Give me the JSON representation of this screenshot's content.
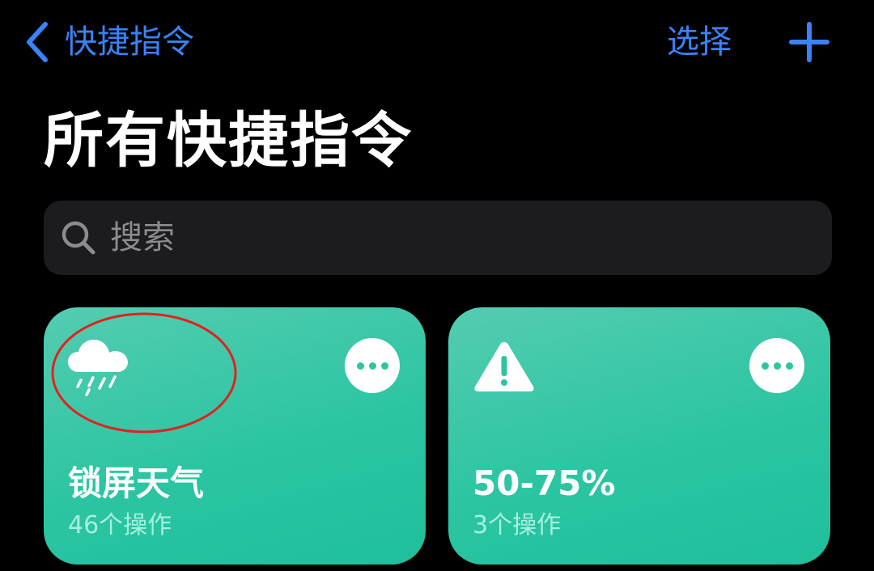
{
  "nav": {
    "back_label": "快捷指令",
    "select_label": "选择",
    "add_icon": "plus-icon",
    "back_icon": "chevron-left-icon"
  },
  "page": {
    "title": "所有快捷指令"
  },
  "search": {
    "placeholder": "搜索",
    "value": "",
    "icon": "search-icon"
  },
  "cards": [
    {
      "title": "锁屏天气",
      "subtitle": "46个操作",
      "icon": "cloud-rain-icon",
      "more_icon": "ellipsis-icon"
    },
    {
      "title": "50-75%",
      "subtitle": "3个操作",
      "icon": "warning-triangle-icon",
      "more_icon": "ellipsis-icon"
    }
  ],
  "colors": {
    "accent": "#3a82f7",
    "background": "#000000",
    "search_bg": "#1c1c1e",
    "card_green": "#2cc5a2",
    "card_subtitle": "#a6f0df",
    "annotation": "#e0221f"
  }
}
